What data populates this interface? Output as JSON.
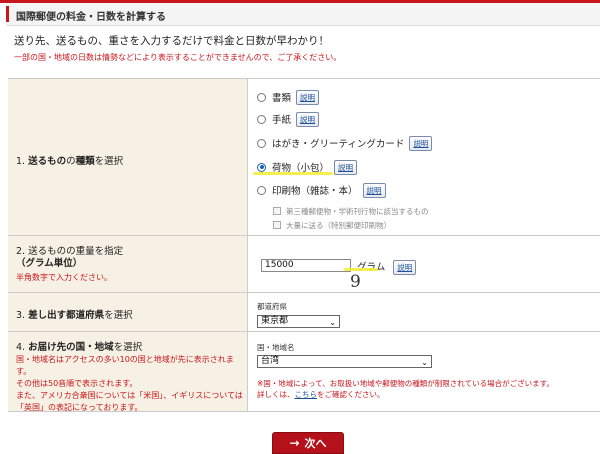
{
  "header": {
    "title": "国際郵便の料金・日数を計算する"
  },
  "intro": "送り先、送るもの、重さを入力するだけで料金と日数が早わかり！",
  "note": "一部の国・地域の日数は情勢などにより表示することができませんので、ご了承ください。",
  "explain_label": "説明",
  "item_type": {
    "label_num": "1.",
    "label_bold": "送るもの",
    "label_mid": "の",
    "label_bold2": "種類",
    "label_end": "を選択",
    "options": [
      "書類",
      "手紙",
      "はがき・グリーティングカード",
      "荷物（小包）",
      "印刷物（雑誌・本）"
    ],
    "selected_index": 3,
    "sub_options": [
      "第三種郵便物・学術刊行物に該当するもの",
      "大量に送る（特別郵便印刷物）"
    ]
  },
  "weight": {
    "label_line1": "2. 送るものの重量を指定",
    "label_line2": "（グラム単位）",
    "hint": "半角数字で入力ください。",
    "value": "15000",
    "unit": "グラム",
    "handwritten": "9"
  },
  "prefecture": {
    "label_num": "3.",
    "label_bold": "差し出す都道府県",
    "label_end": "を選択",
    "field_label": "都道府県",
    "selected": "東京都"
  },
  "destination": {
    "label_num": "4.",
    "label_bold": "お届け先の国・地域",
    "label_end": "を選択",
    "notes": [
      "国・地域名はアクセスの多い10の国と地域が先に表示されます。",
      "その他は50音順で表示されます。",
      "また、アメリカ合衆国については「米国」、イギリスについては",
      "「英国」の表記になっております。"
    ],
    "field_label": "国・地域名",
    "selected": "台湾",
    "warn_line1": "※国・地域によって、お取扱い地域や郵便物の種類が制限されている場合がございます。",
    "warn_line2_pre": "詳しくは、",
    "warn_link": "こちら",
    "warn_line2_post": "をご確認ください。"
  },
  "next_button": {
    "label": "次へ",
    "arrow": "→"
  }
}
